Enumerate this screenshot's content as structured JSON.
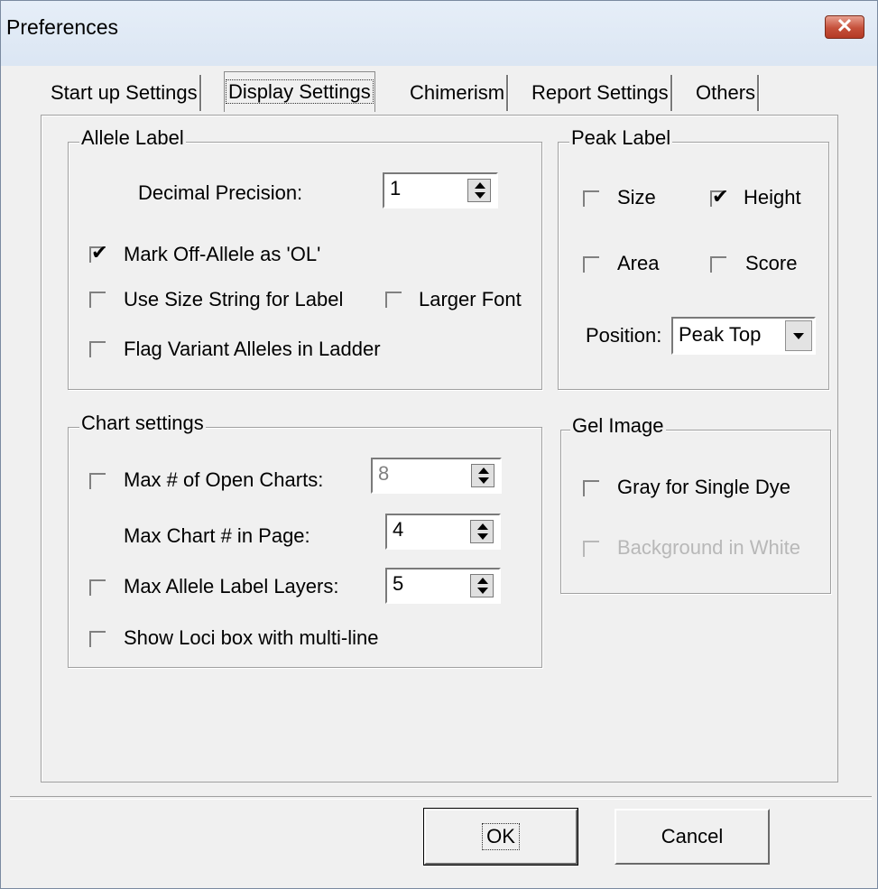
{
  "window": {
    "title": "Preferences",
    "close_glyph": "✕"
  },
  "tabs": [
    {
      "label": "Start up Settings"
    },
    {
      "label": "Display Settings",
      "active": true
    },
    {
      "label": "Chimerism"
    },
    {
      "label": "Report Settings"
    },
    {
      "label": "Others"
    }
  ],
  "allele_label": {
    "legend": "Allele Label",
    "decimal_precision_label": "Decimal Precision:",
    "decimal_precision_value": "1",
    "mark_off_allele": {
      "label": "Mark Off-Allele as 'OL'",
      "checked": true
    },
    "use_size_string": {
      "label": "Use Size String for Label",
      "checked": false
    },
    "larger_font": {
      "label": "Larger Font",
      "checked": false
    },
    "flag_variant": {
      "label": "Flag Variant Alleles in Ladder",
      "checked": false
    }
  },
  "peak_label": {
    "legend": "Peak Label",
    "size": {
      "label": "Size",
      "checked": false
    },
    "height": {
      "label": "Height",
      "checked": true
    },
    "area": {
      "label": "Area",
      "checked": false
    },
    "score": {
      "label": "Score",
      "checked": false
    },
    "position_label": "Position:",
    "position_value": "Peak Top"
  },
  "chart_settings": {
    "legend": "Chart settings",
    "max_open_charts": {
      "label": "Max # of Open Charts:",
      "checked": false,
      "value": "8",
      "enabled": false
    },
    "max_chart_in_page": {
      "label": "Max Chart # in Page:",
      "value": "4"
    },
    "max_allele_label_layers": {
      "label": "Max Allele Label Layers:",
      "checked": false,
      "value": "5"
    },
    "show_loci_box": {
      "label": "Show Loci box with multi-line",
      "checked": false
    }
  },
  "gel_image": {
    "legend": "Gel Image",
    "gray_single_dye": {
      "label": "Gray for Single Dye",
      "checked": false
    },
    "background_white": {
      "label": "Background in White",
      "checked": false,
      "enabled": false
    }
  },
  "buttons": {
    "ok": "OK",
    "cancel": "Cancel"
  }
}
